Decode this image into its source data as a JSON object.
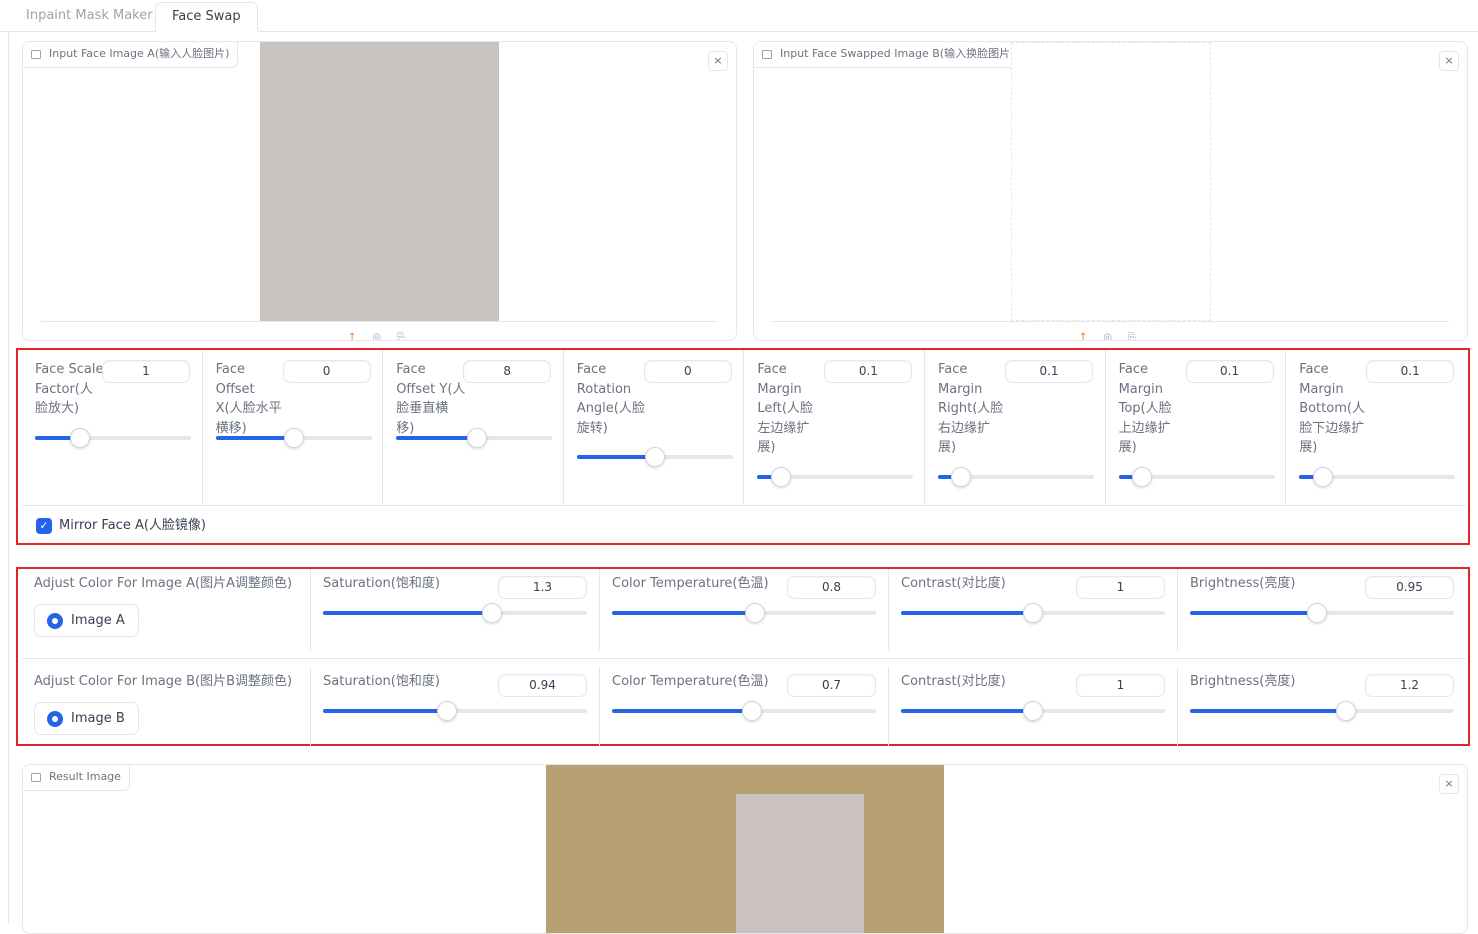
{
  "tabs": [
    {
      "label": "Inpaint Mask Maker",
      "active": false
    },
    {
      "label": "Face Swap",
      "active": true
    }
  ],
  "input_a": {
    "label": "Input Face Image A(输入人脸图片)",
    "icon": "image-icon",
    "close": "×"
  },
  "input_b": {
    "label": "Input Face Swapped Image B(输入换脸图片)",
    "icon": "image-icon",
    "close": "×"
  },
  "toolbar": {
    "upload": "↑",
    "webcam": "◎",
    "clipboard": "⎘"
  },
  "face_params": [
    {
      "label": "Face Scale Factor(人脸放大)",
      "value": "1",
      "fraction": 0.29
    },
    {
      "label": "Face Offset X(人脸水平横移)",
      "value": "0",
      "fraction": 0.5
    },
    {
      "label": "Face Offset Y(人脸垂直横移)",
      "value": "8",
      "fraction": 0.52
    },
    {
      "label": "Face Rotation Angle(人脸旋转)",
      "value": "0",
      "fraction": 0.5
    },
    {
      "label": "Face Margin Left(人脸左边缘扩展)",
      "value": "0.1",
      "fraction": 0.15
    },
    {
      "label": "Face Margin Right(人脸右边缘扩展)",
      "value": "0.1",
      "fraction": 0.15
    },
    {
      "label": "Face Margin Top(人脸上边缘扩展)",
      "value": "0.1",
      "fraction": 0.15
    },
    {
      "label": "Face Margin Bottom(人脸下边缘扩展)",
      "value": "0.1",
      "fraction": 0.15
    }
  ],
  "mirror": {
    "label": "Mirror Face A(人脸镜像)",
    "checked": true
  },
  "color_a": {
    "title": "Adjust Color For Image A(图片A调整颜色)",
    "radio": "Image A",
    "sliders": [
      {
        "label": "Saturation(饱和度)",
        "value": "1.3",
        "fraction": 0.64
      },
      {
        "label": "Color Temperature(色温)",
        "value": "0.8",
        "fraction": 0.54
      },
      {
        "label": "Contrast(对比度)",
        "value": "1",
        "fraction": 0.5
      },
      {
        "label": "Brightness(亮度)",
        "value": "0.95",
        "fraction": 0.48
      }
    ]
  },
  "color_b": {
    "title": "Adjust Color For Image B(图片B调整颜色)",
    "radio": "Image B",
    "sliders": [
      {
        "label": "Saturation(饱和度)",
        "value": "0.94",
        "fraction": 0.47
      },
      {
        "label": "Color Temperature(色温)",
        "value": "0.7",
        "fraction": 0.53
      },
      {
        "label": "Contrast(对比度)",
        "value": "1",
        "fraction": 0.5
      },
      {
        "label": "Brightness(亮度)",
        "value": "1.2",
        "fraction": 0.59
      }
    ]
  },
  "result": {
    "label": "Result Image",
    "icon": "image-icon",
    "close": "×"
  },
  "colors": {
    "accent": "#2563eb",
    "highlight_border": "#e0262a",
    "upload_icon": "#f97316"
  }
}
